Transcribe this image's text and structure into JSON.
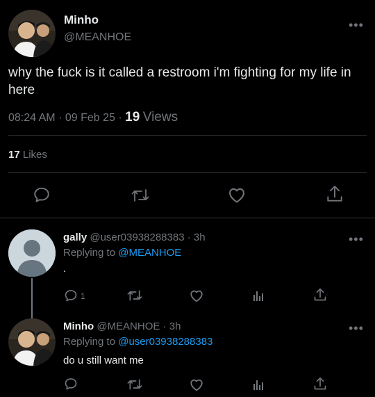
{
  "main_tweet": {
    "author_name": "Minho",
    "author_handle": "@MEANHOE",
    "text": "why the fuck is it called a restroom i'm fighting for my life in here",
    "time": "08:24 AM",
    "date": "09 Feb 25",
    "views_count": "19",
    "views_label": "Views",
    "likes_count": "17",
    "likes_label": "Likes",
    "more_label": "•••"
  },
  "replies": [
    {
      "author_name": "gally",
      "author_handle": "@user03938288383",
      "time_ago": "3h",
      "replying_prefix": "Replying to",
      "replying_to": "@MEANHOE",
      "text": ".",
      "reply_count": "1",
      "more_label": "•••"
    },
    {
      "author_name": "Minho",
      "author_handle": "@MEANHOE",
      "time_ago": "3h",
      "replying_prefix": "Replying to",
      "replying_to": "@user03938288383",
      "text": "do u still want me",
      "more_label": "•••"
    }
  ],
  "separator": "·",
  "colors": {
    "background": "#000000",
    "text": "#e7e9ea",
    "muted": "#71767b",
    "link": "#1d9bf0",
    "divider": "#2f3336"
  },
  "icons": {
    "action_bar": [
      "reply-icon",
      "retweet-icon",
      "like-icon",
      "share-icon"
    ],
    "reply_action_bar": [
      "reply-icon",
      "retweet-icon",
      "like-icon",
      "analytics-icon",
      "share-icon"
    ]
  }
}
